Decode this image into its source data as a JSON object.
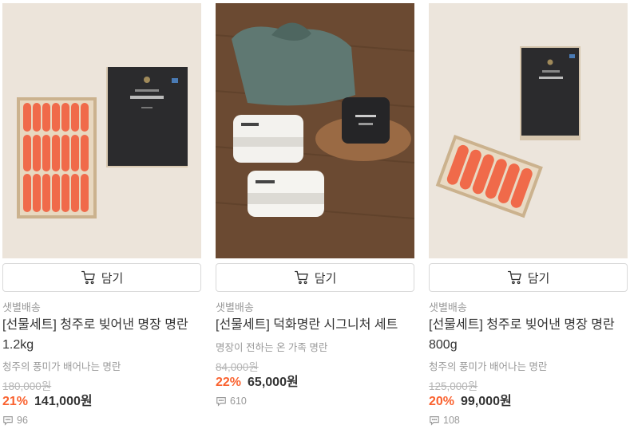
{
  "products": [
    {
      "image_desc": "gift-box-mentaiko-large",
      "cart_label": "담기",
      "delivery": "샛별배송",
      "title": "[선물세트] 청주로 빚어낸 명장 명란 1.2kg",
      "subtitle": "청주의 풍미가 배어나는 명란",
      "original_price": "180,000원",
      "discount": "21%",
      "price": "141,000원",
      "reviews": "96"
    },
    {
      "image_desc": "signature-set-bojagi",
      "cart_label": "담기",
      "delivery": "샛별배송",
      "title": "[선물세트] 덕화명란 시그니처 세트",
      "subtitle": "명장이 전하는 온 가족 명란",
      "original_price": "84,000원",
      "discount": "22%",
      "price": "65,000원",
      "reviews": "610"
    },
    {
      "image_desc": "gift-box-mentaiko-small",
      "cart_label": "담기",
      "delivery": "샛별배송",
      "title": "[선물세트] 청주로 빚어낸 명장 명란 800g",
      "subtitle": "청주의 풍미가 배어나는 명란",
      "original_price": "125,000원",
      "discount": "20%",
      "price": "99,000원",
      "reviews": "108"
    }
  ],
  "colors": {
    "discount": "#fa622f",
    "muted": "#999999",
    "strike": "#b5b5b5",
    "text": "#333333"
  },
  "icons": [
    "cart-icon",
    "speech-bubble-icon"
  ]
}
